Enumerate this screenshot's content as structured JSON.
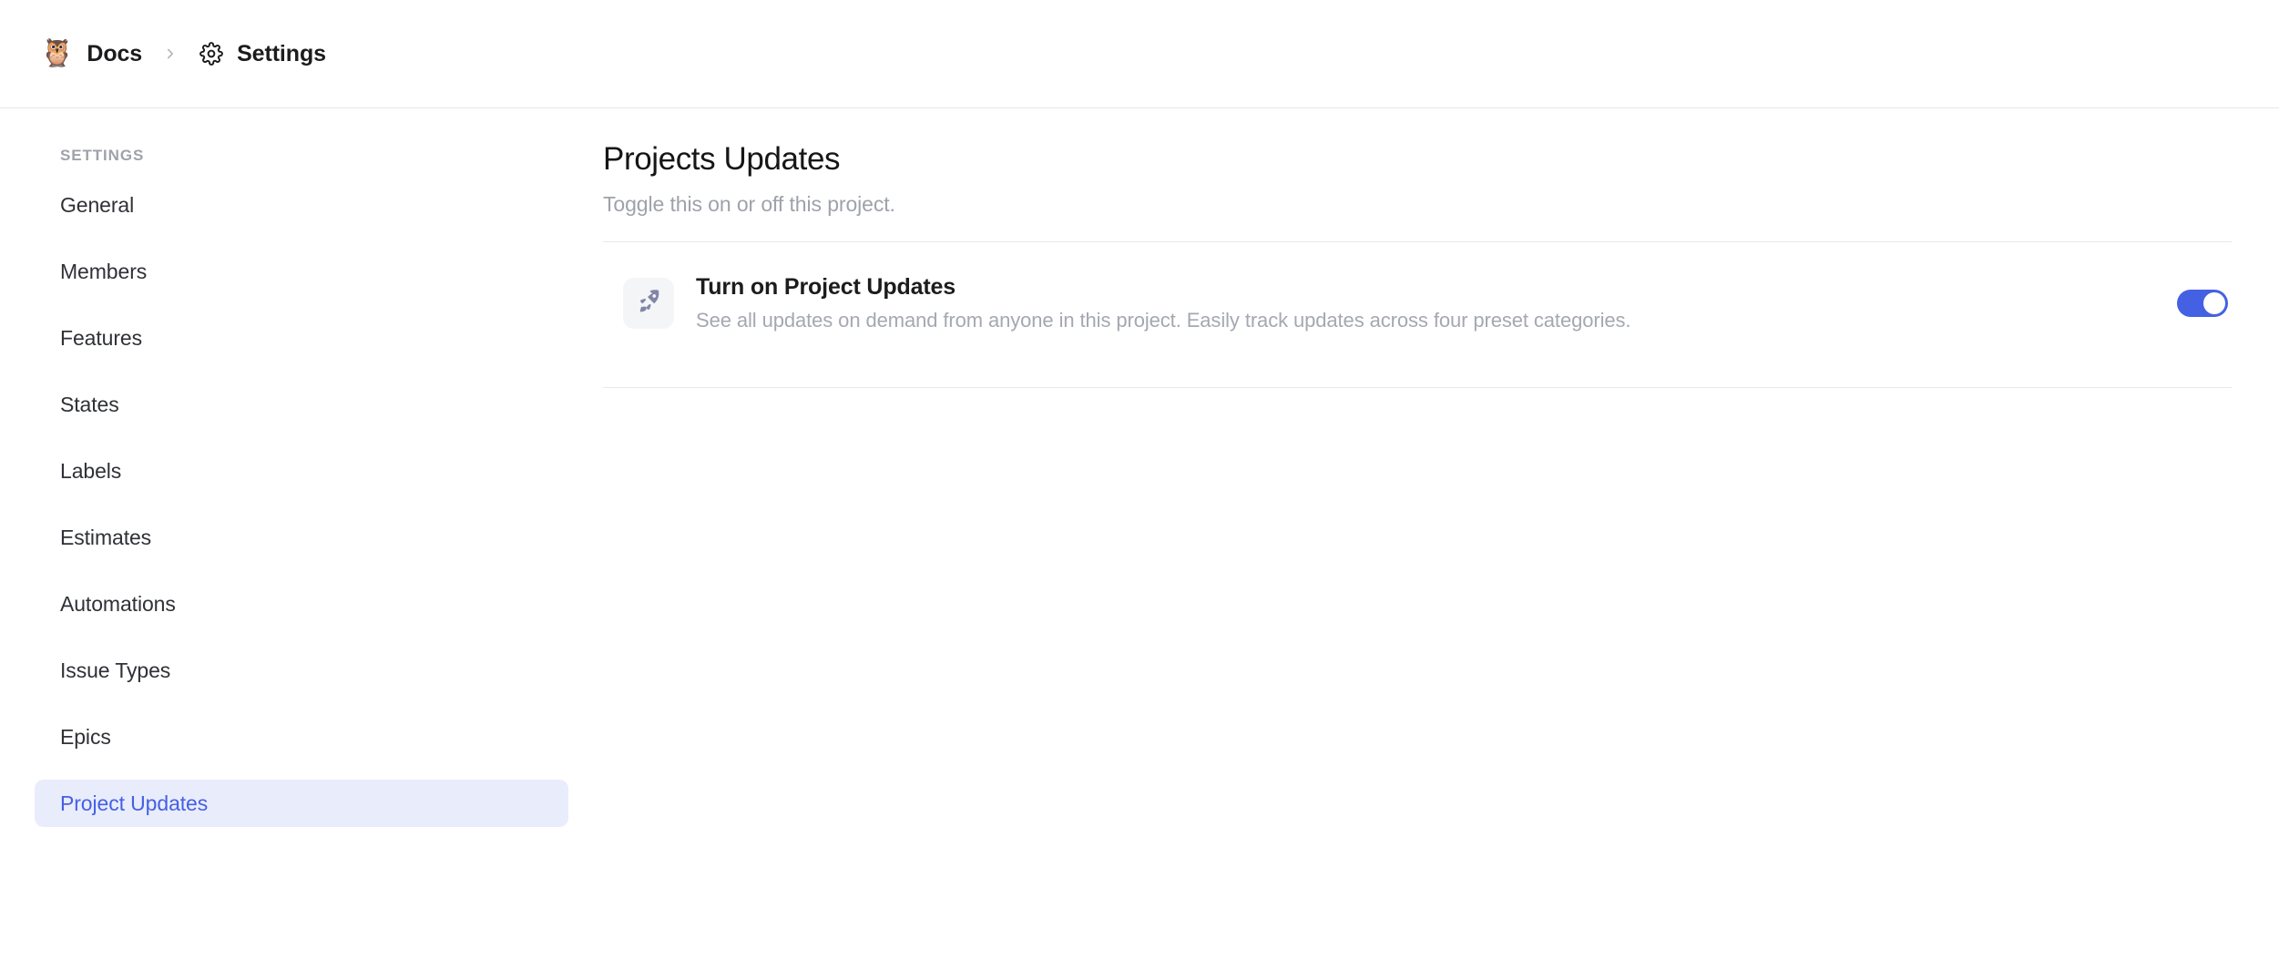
{
  "header": {
    "breadcrumb": {
      "workspace_emoji": "🦉",
      "workspace_label": "Docs",
      "separator_icon": "chevron-right-icon",
      "settings_icon": "gear-icon",
      "settings_label": "Settings"
    }
  },
  "sidebar": {
    "section_title": "SETTINGS",
    "items": [
      {
        "label": "General",
        "active": false
      },
      {
        "label": "Members",
        "active": false
      },
      {
        "label": "Features",
        "active": false
      },
      {
        "label": "States",
        "active": false
      },
      {
        "label": "Labels",
        "active": false
      },
      {
        "label": "Estimates",
        "active": false
      },
      {
        "label": "Automations",
        "active": false
      },
      {
        "label": "Issue Types",
        "active": false
      },
      {
        "label": "Epics",
        "active": false
      },
      {
        "label": "Project Updates",
        "active": true
      }
    ]
  },
  "main": {
    "title": "Projects Updates",
    "subtitle": "Toggle this on or off this project.",
    "feature": {
      "icon": "rocket-icon",
      "title": "Turn on Project Updates",
      "description": "See all updates on demand from anyone in this project. Easily track updates across four preset categories.",
      "toggle_state": "on"
    }
  },
  "colors": {
    "accent_blue": "#4461e4",
    "active_nav_bg": "#e9ecfb",
    "divider": "#e8e8ea",
    "muted_text": "#9ea2aa",
    "icon_tile_bg": "#f4f5f7",
    "rocket_glyph": "#8186a8"
  }
}
